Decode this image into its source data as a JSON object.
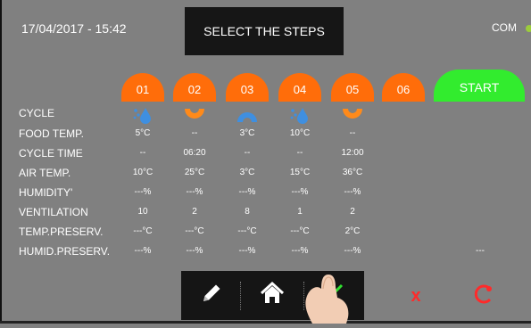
{
  "header": {
    "datetime": "17/04/2017 - 15:42",
    "title": "SELECT THE STEPS",
    "com_label": "COM",
    "com_color": "#9ccc3c"
  },
  "steps": [
    "01",
    "02",
    "03",
    "04",
    "05",
    "06"
  ],
  "start_label": "START",
  "colors": {
    "step_tab": "#ff6d0a",
    "start": "#32ec2e",
    "drop": "#3f8fe0",
    "wave": "#ff8a1a"
  },
  "rows": [
    {
      "label": "CYCLE",
      "cells": []
    },
    {
      "label": "FOOD TEMP.",
      "cells": [
        "5°C",
        "--",
        "3°C",
        "10°C",
        "--"
      ]
    },
    {
      "label": "CYCLE TIME",
      "cells": [
        "--",
        "06:20",
        "--",
        "--",
        "12:00"
      ]
    },
    {
      "label": "AIR TEMP.",
      "cells": [
        "10°C",
        "25°C",
        "3°C",
        "15°C",
        "36°C"
      ]
    },
    {
      "label": "HUMIDITY'",
      "cells": [
        "---%",
        "---%",
        "---%",
        "---%",
        "---%"
      ]
    },
    {
      "label": "VENTILATION",
      "cells": [
        "10",
        "2",
        "8",
        "1",
        "2"
      ]
    },
    {
      "label": "TEMP.PRESERV.",
      "cells": [
        "---°C",
        "---°C",
        "---°C",
        "---°C",
        "2°C"
      ]
    },
    {
      "label": "HUMID.PRESERV.",
      "cells": [
        "---%",
        "---%",
        "---%",
        "---%",
        "---%",
        "",
        "---"
      ]
    }
  ],
  "cycle_icons": [
    "drops-blue-icon",
    "hot-arc-orange-icon",
    "cold-arc-blue-icon",
    "drops-blue-icon",
    "hot-arc-orange-icon"
  ],
  "toolbar": {
    "edit_icon": "pencil-icon",
    "home_icon": "home-icon",
    "confirm_icon": "check-icon",
    "cancel_icon": "x-icon",
    "reset_icon": "reset-icon"
  },
  "cancel_label": "x"
}
